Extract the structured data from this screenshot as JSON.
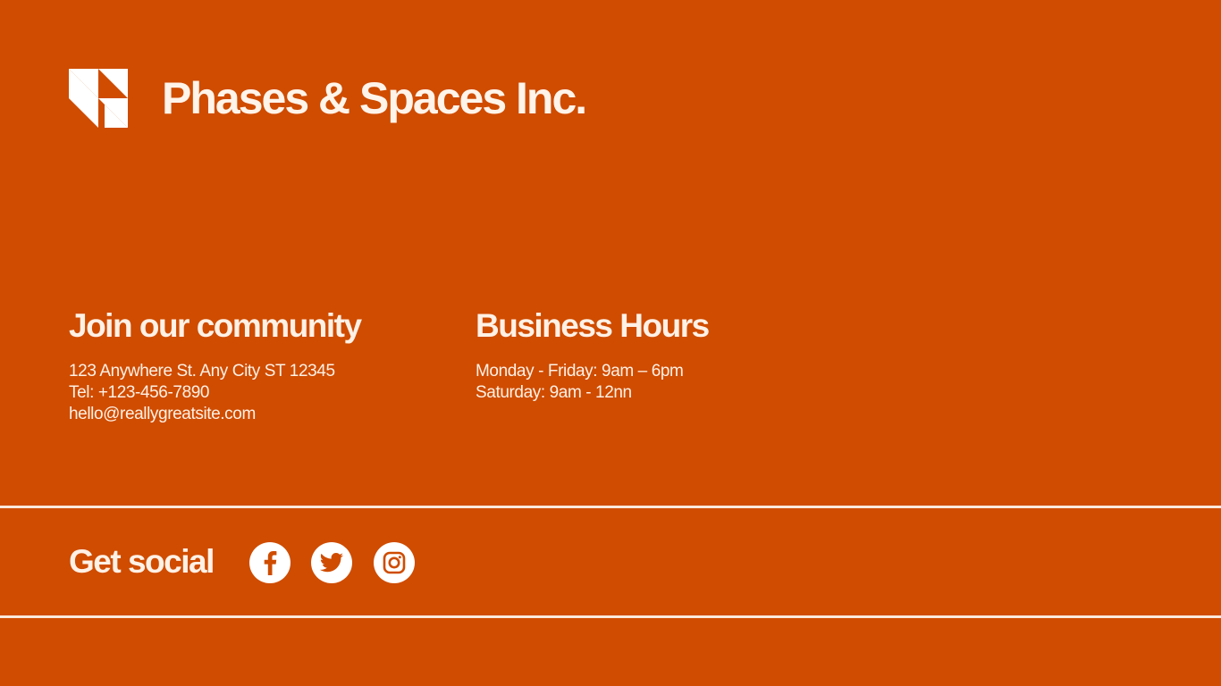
{
  "brand": {
    "name": "Phases & Spaces Inc.",
    "logo_icon": "triangle-grid-logo-icon"
  },
  "community": {
    "title": "Join our community",
    "address": "123 Anywhere St. Any City ST 12345",
    "phone": "Tel: +123-456-7890",
    "email": "hello@reallygreatsite.com"
  },
  "hours": {
    "title": "Business Hours",
    "weekday": "Monday - Friday: 9am – 6pm",
    "saturday": "Saturday: 9am - 12nn"
  },
  "social": {
    "title": "Get social",
    "icons": [
      "facebook-icon",
      "twitter-icon",
      "instagram-icon"
    ]
  },
  "colors": {
    "background": "#cf4c00",
    "foreground": "#ffffff"
  }
}
